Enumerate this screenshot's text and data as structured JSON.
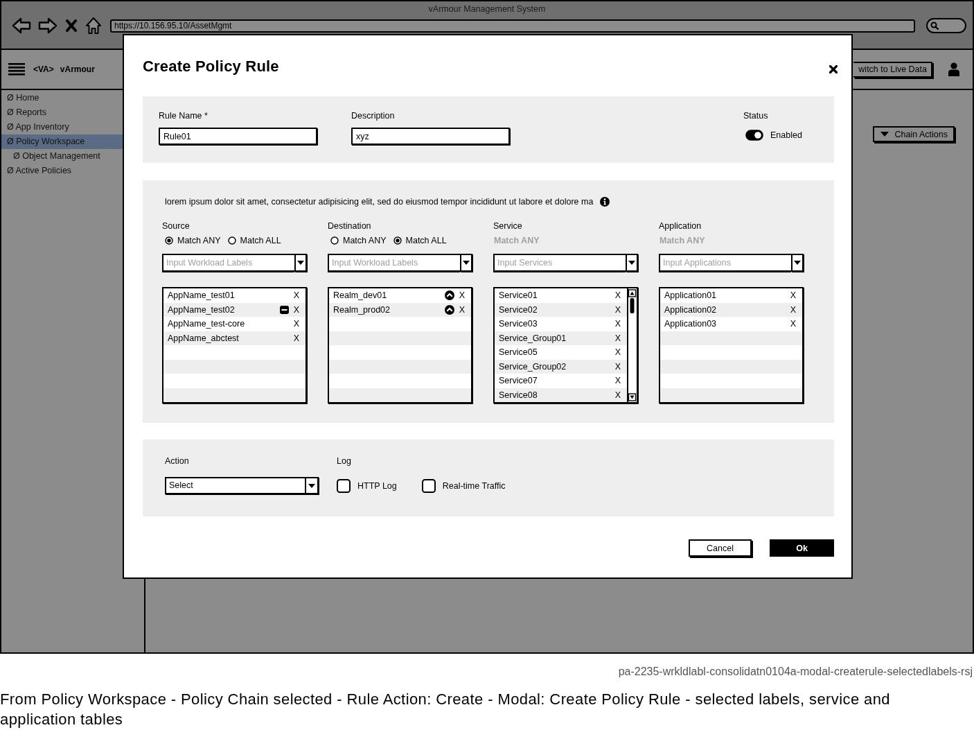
{
  "window": {
    "title": "vArmour Management System",
    "url": "https://10.156.95.10/AssetMgmt"
  },
  "app_header": {
    "logo": "<VA>",
    "app_name": "vArmour",
    "switch_button": "witch to Live Data"
  },
  "sidebar": {
    "items": [
      {
        "label": "Ø Home",
        "selected": false
      },
      {
        "label": "Ø Reports",
        "selected": false
      },
      {
        "label": "Ø App Inventory",
        "selected": false
      },
      {
        "label": "Ø Policy Workspace",
        "selected": true,
        "children": [
          {
            "label": "Ø Object Management",
            "selected": false
          }
        ]
      },
      {
        "label": "Ø Active Policies",
        "selected": false
      }
    ]
  },
  "content": {
    "chain_actions_button": "Chain Actions"
  },
  "modal": {
    "title": "Create Policy Rule",
    "general": {
      "rule_name": {
        "label": "Rule Name *",
        "value": "Rule01"
      },
      "description": {
        "label": "Description",
        "value": "xyz"
      },
      "status": {
        "label": "Status",
        "on": true,
        "text": "Enabled"
      }
    },
    "selectors": {
      "info_text": "lorem ipsum dolor sit amet, consectetur adipisicing elit, sed do eiusmod tempor incididunt ut labore et dolore ma",
      "columns": [
        {
          "heading": "Source",
          "kind": "radio",
          "match_options": [
            {
              "label": "Match ANY",
              "selected": true
            },
            {
              "label": "Match ALL",
              "selected": false
            }
          ],
          "input": {
            "placeholder": "Input Workload Labels"
          },
          "scrollable": false,
          "items": [
            {
              "label": "AppName_test01",
              "kind": "plain",
              "remove": "X"
            },
            {
              "label": "AppName_test02",
              "kind": "minus",
              "remove": "X"
            },
            {
              "label": "AppName_test-core",
              "kind": "plain",
              "remove": "X"
            },
            {
              "label": "AppName_abctest",
              "kind": "plain",
              "remove": "X"
            }
          ]
        },
        {
          "heading": "Destination",
          "kind": "radio",
          "match_options": [
            {
              "label": "Match ANY",
              "selected": false
            },
            {
              "label": "Match ALL",
              "selected": true
            }
          ],
          "input": {
            "placeholder": "Input Workload Labels"
          },
          "scrollable": false,
          "items": [
            {
              "label": "Realm_dev01",
              "kind": "caret",
              "remove": "X"
            },
            {
              "label": "Realm_prod02",
              "kind": "caret",
              "remove": "X"
            }
          ]
        },
        {
          "heading": "Service",
          "kind": "fixed",
          "match_options": [
            {
              "label": "Match ANY",
              "disabled": true
            }
          ],
          "input": {
            "placeholder": "Input Services"
          },
          "scrollable": true,
          "items": [
            {
              "label": "Service01",
              "kind": "plain",
              "remove": "X"
            },
            {
              "label": "Service02",
              "kind": "plain",
              "remove": "X"
            },
            {
              "label": "Service03",
              "kind": "plain",
              "remove": "X"
            },
            {
              "label": "Service_Group01",
              "kind": "plain",
              "remove": "X"
            },
            {
              "label": "Service05",
              "kind": "plain",
              "remove": "X"
            },
            {
              "label": "Service_Group02",
              "kind": "plain",
              "remove": "X"
            },
            {
              "label": "Service07",
              "kind": "plain",
              "remove": "X"
            },
            {
              "label": "Service08",
              "kind": "plain",
              "remove": "X"
            }
          ]
        },
        {
          "heading": "Application",
          "kind": "fixed",
          "match_options": [
            {
              "label": "Match ANY",
              "disabled": true
            }
          ],
          "input": {
            "placeholder": "Input Applications"
          },
          "scrollable": false,
          "items": [
            {
              "label": "Application01",
              "kind": "plain",
              "remove": "X"
            },
            {
              "label": "Application02",
              "kind": "plain",
              "remove": "X"
            },
            {
              "label": "Application03",
              "kind": "plain",
              "remove": "X"
            }
          ]
        }
      ]
    },
    "action": {
      "label": "Action",
      "value": "Select"
    },
    "log": {
      "label": "Log",
      "options": [
        {
          "label": "HTTP Log",
          "checked": false
        },
        {
          "label": "Real-time Traffic",
          "checked": false
        }
      ]
    },
    "buttons": [
      {
        "label": "Cancel",
        "kind": "secondary"
      },
      {
        "label": "Ok",
        "kind": "primary"
      }
    ]
  },
  "caption": {
    "file_name": "pa-2235-wrkldlabl-consolidatn0104a-modal-createrule-selectedlabels-rsj",
    "description": "From Policy Workspace - Policy Chain selected - Rule Action: Create - Modal: Create Policy Rule - selected labels, service and application tables"
  }
}
